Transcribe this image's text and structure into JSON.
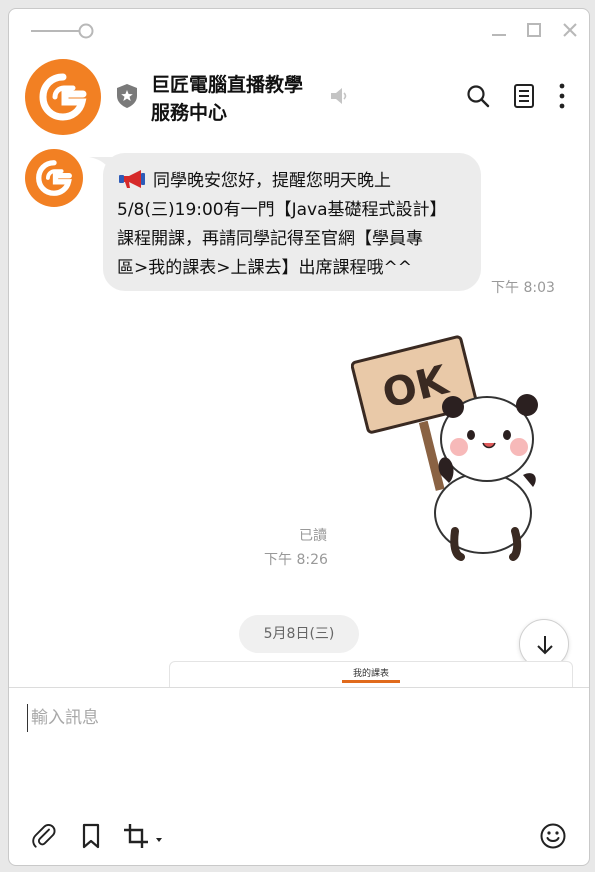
{
  "header": {
    "title_line1": "巨匠電腦直播教學",
    "title_line2": "服務中心"
  },
  "messages": {
    "bubble_line1": "同學晚安您好，提醒您明天晚上",
    "bubble_line2": "5/8(三)19:00有一門【Java基礎程式設計】",
    "bubble_line3": "課程開課，再請同學記得至官網【學員專",
    "bubble_line4": "區>我的課表>上課去】出席課程哦^^",
    "bubble_time": "下午 8:03",
    "sticker_text": "OK",
    "read_status": "已讀",
    "sticker_time": "下午 8:26",
    "date_divider": "5月8日(三)",
    "card_title": "我的課表"
  },
  "composer": {
    "placeholder": "輸入訊息"
  },
  "colors": {
    "brand": "#f28023",
    "bubble": "#ececec",
    "muted": "#999999"
  }
}
